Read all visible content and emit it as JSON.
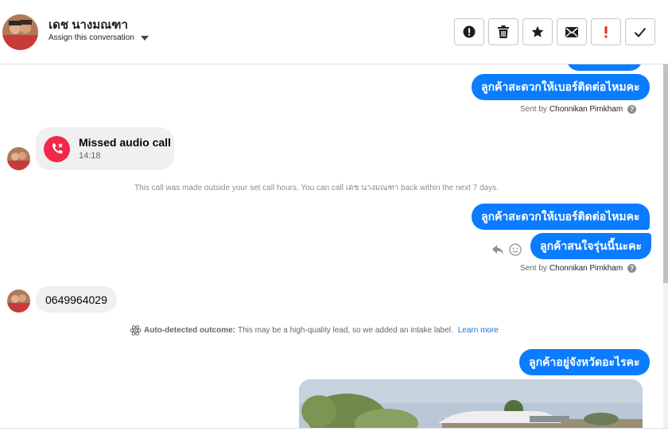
{
  "header": {
    "contact_name": "เดช นางมณฑา",
    "assign_label": "Assign this conversation",
    "actions": [
      {
        "name": "mark-spam-button",
        "icon": "alert-circle-icon"
      },
      {
        "name": "delete-button",
        "icon": "trash-icon"
      },
      {
        "name": "star-button",
        "icon": "star-icon"
      },
      {
        "name": "mark-unread-button",
        "icon": "envelope-icon"
      },
      {
        "name": "follow-up-button",
        "icon": "exclamation-icon"
      },
      {
        "name": "mark-done-button",
        "icon": "check-icon"
      }
    ]
  },
  "messages": {
    "out_1": "ลูกค้าสะดวกให้เบอร์ติดต่อไหมคะ",
    "sent_by_1": {
      "prefix": "Sent by",
      "agent": "Chonnikan Pimkham"
    },
    "missed_call": {
      "title": "Missed audio call",
      "time": "14:18"
    },
    "call_note": "This call was made outside your set call hours. You can call เดช นางมณฑา back within the next 7 days.",
    "out_2": "ลูกค้าสะดวกให้เบอร์ติดต่อไหมคะ",
    "out_3": "ลูกค้าสนใจรุ่นนี้นะคะ",
    "sent_by_2": {
      "prefix": "Sent by",
      "agent": "Chonnikan Pimkham"
    },
    "in_phone": "0649964029",
    "outcome": {
      "label": "Auto-detected outcome:",
      "text": "This may be a high-quality lead, so we added an intake label.",
      "link": "Learn more"
    },
    "out_4": "ลูกค้าอยู่จังหวัดอะไรคะ"
  },
  "colors": {
    "accent": "#0a7cff",
    "missed_call": "#f02849",
    "follow_up": "#e4251b"
  }
}
